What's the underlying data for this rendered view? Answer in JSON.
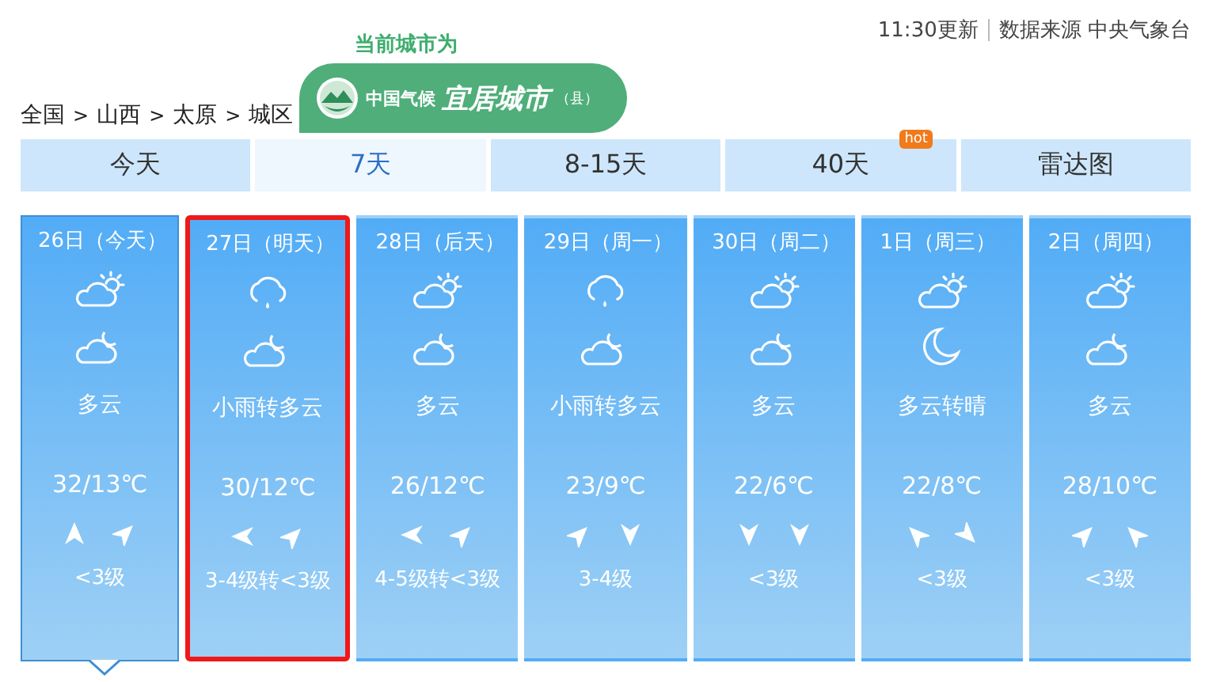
{
  "breadcrumb": {
    "separator": ">",
    "items": [
      "全国",
      "山西",
      "太原",
      "城区"
    ]
  },
  "badge": {
    "caption": "当前城市为",
    "org": "中国气候",
    "title": "宜居城市",
    "suffix": "（县）"
  },
  "update": {
    "time": "11:30更新",
    "source": "数据来源 中央气象台"
  },
  "tabs": [
    {
      "label": "今天",
      "selected": false
    },
    {
      "label": "7天",
      "selected": true
    },
    {
      "label": "8-15天",
      "selected": false
    },
    {
      "label": "40天",
      "selected": false,
      "tag": "hot"
    },
    {
      "label": "雷达图",
      "selected": false
    }
  ],
  "days": [
    {
      "date": "26日（今天）",
      "icons": [
        {
          "kind": "partly-cloudy"
        },
        {
          "kind": "cloudy-night"
        }
      ],
      "weather": "多云",
      "temp": "32/13℃",
      "winds": [
        {
          "kind": "up"
        },
        {
          "kind": "up-right"
        }
      ],
      "wind_level": "<3级",
      "selected": true,
      "highlighted": false
    },
    {
      "date": "27日（明天）",
      "icons": [
        {
          "kind": "rain"
        },
        {
          "kind": "cloudy-night"
        }
      ],
      "weather": "小雨转多云",
      "temp": "30/12℃",
      "winds": [
        {
          "kind": "left"
        },
        {
          "kind": "up-right"
        }
      ],
      "wind_level": "3-4级转<3级",
      "selected": false,
      "highlighted": true
    },
    {
      "date": "28日（后天）",
      "icons": [
        {
          "kind": "partly-cloudy"
        },
        {
          "kind": "cloudy-night"
        }
      ],
      "weather": "多云",
      "temp": "26/12℃",
      "winds": [
        {
          "kind": "left"
        },
        {
          "kind": "up-right"
        }
      ],
      "wind_level": "4-5级转<3级",
      "selected": false,
      "highlighted": false
    },
    {
      "date": "29日（周一）",
      "icons": [
        {
          "kind": "rain"
        },
        {
          "kind": "cloudy-night"
        }
      ],
      "weather": "小雨转多云",
      "temp": "23/9℃",
      "winds": [
        {
          "kind": "up-right"
        },
        {
          "kind": "down"
        }
      ],
      "wind_level": "3-4级",
      "selected": false,
      "highlighted": false
    },
    {
      "date": "30日（周二）",
      "icons": [
        {
          "kind": "partly-cloudy"
        },
        {
          "kind": "cloudy-night"
        }
      ],
      "weather": "多云",
      "temp": "22/6℃",
      "winds": [
        {
          "kind": "down"
        },
        {
          "kind": "down"
        }
      ],
      "wind_level": "<3级",
      "selected": false,
      "highlighted": false
    },
    {
      "date": "1日（周三）",
      "icons": [
        {
          "kind": "partly-cloudy"
        },
        {
          "kind": "moon"
        }
      ],
      "weather": "多云转晴",
      "temp": "22/8℃",
      "winds": [
        {
          "kind": "up-left"
        },
        {
          "kind": "down-right"
        }
      ],
      "wind_level": "<3级",
      "selected": false,
      "highlighted": false
    },
    {
      "date": "2日（周四）",
      "icons": [
        {
          "kind": "partly-cloudy"
        },
        {
          "kind": "cloudy-night"
        }
      ],
      "weather": "多云",
      "temp": "28/10℃",
      "winds": [
        {
          "kind": "up-right"
        },
        {
          "kind": "up-left"
        }
      ],
      "wind_level": "<3级",
      "selected": false,
      "highlighted": false
    }
  ]
}
